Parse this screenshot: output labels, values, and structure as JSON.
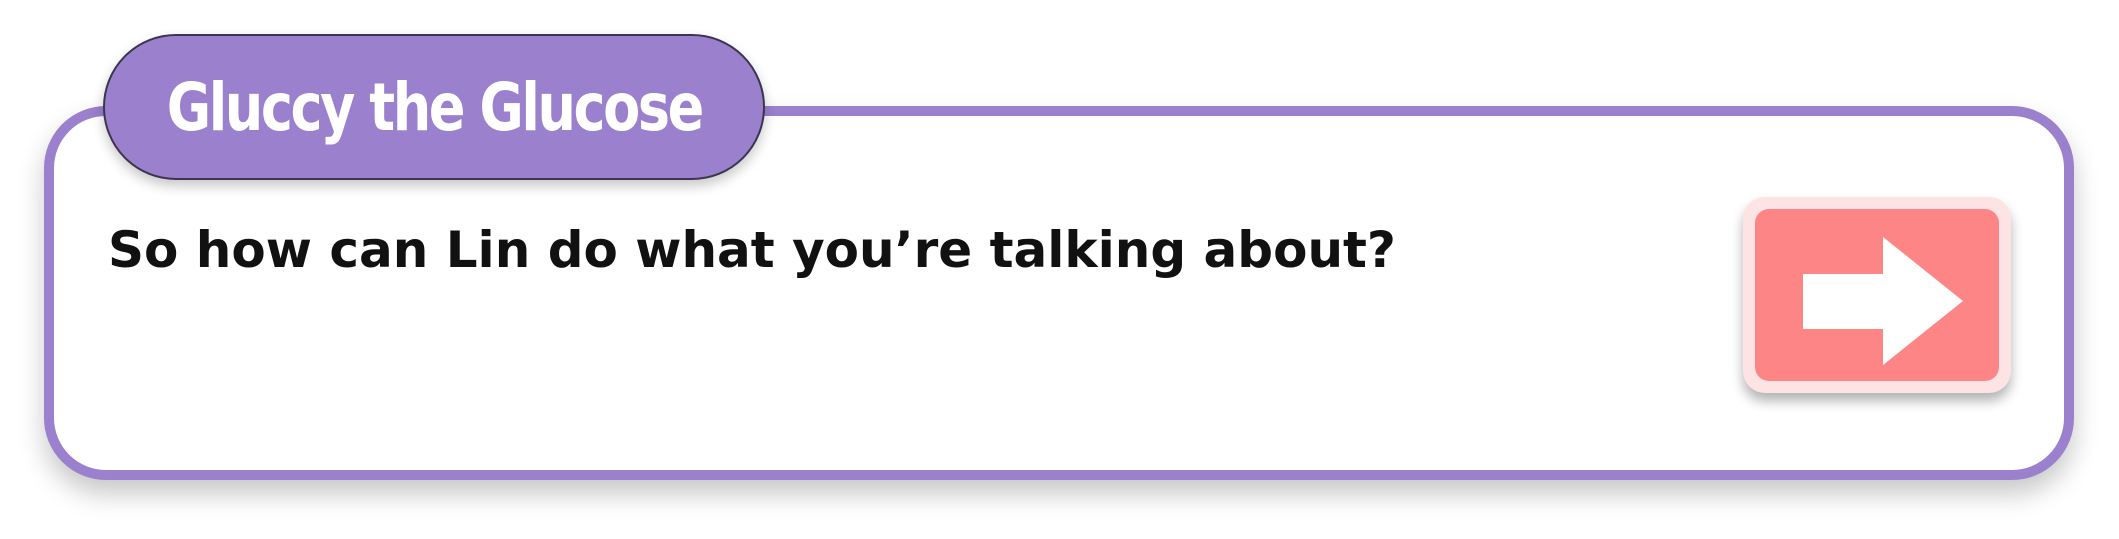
{
  "dialog": {
    "speaker": "Gluccy the Glucose",
    "text": "So how can Lin do what you’re talking about?"
  },
  "next_button": {
    "icon": "arrow-right-icon"
  },
  "colors": {
    "accent_purple": "#9b80ce",
    "button_red": "#fd8585",
    "button_border": "#fde3e3"
  }
}
